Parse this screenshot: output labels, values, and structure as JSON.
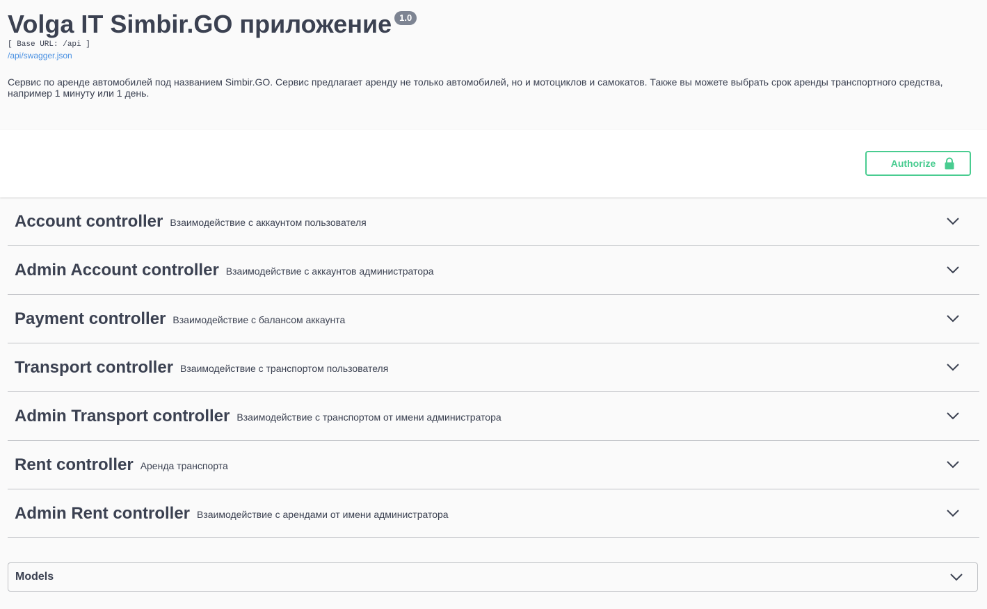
{
  "info": {
    "title": "Volga IT Simbir.GO приложение",
    "version": "1.0",
    "base_url": "[ Base URL: /api ]",
    "spec_link": "/api/swagger.json",
    "description": "Сервис по аренде автомобилей под названием Simbir.GO. Сервис предлагает аренду не только автомобилей, но и мотоциклов и самокатов. Также вы можете выбрать срок аренды транспортного средства, например 1 минуту или 1 день."
  },
  "authorize": {
    "label": "Authorize",
    "icon": "lock-icon",
    "color": "#49cc90"
  },
  "tags": [
    {
      "name": "Account controller",
      "description": "Взаимодействие с аккаунтом пользователя"
    },
    {
      "name": "Admin Account controller",
      "description": "Взаимодействие с аккаунтов администратора"
    },
    {
      "name": "Payment controller",
      "description": "Взаимодействие с балансом аккаунта"
    },
    {
      "name": "Transport controller",
      "description": "Взаимодействие с транспортом пользователя"
    },
    {
      "name": "Admin Transport controller",
      "description": "Взаимодействие с транспортом от имени администратора"
    },
    {
      "name": "Rent controller",
      "description": "Аренда транспорта"
    },
    {
      "name": "Admin Rent controller",
      "description": "Взаимодействие с арендами от имени администратора"
    }
  ],
  "models": {
    "title": "Models"
  }
}
